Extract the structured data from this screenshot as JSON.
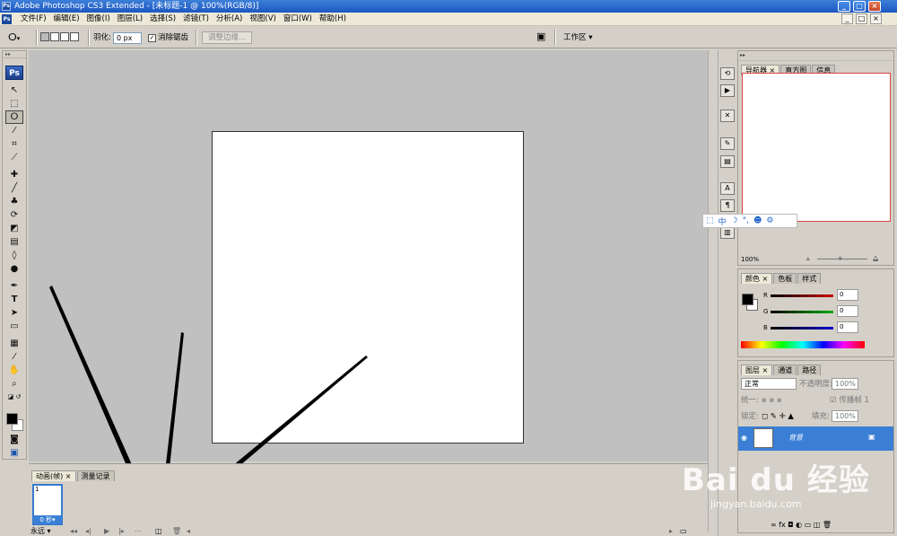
{
  "window": {
    "title": "Adobe Photoshop CS3 Extended - [未标题-1 @ 100%(RGB/8)]",
    "app_icon": "Ps",
    "controls": [
      "_",
      "□",
      "×"
    ]
  },
  "menubar": {
    "items": [
      "文件(F)",
      "编辑(E)",
      "图像(I)",
      "图层(L)",
      "选择(S)",
      "滤镜(T)",
      "分析(A)",
      "视图(V)",
      "窗口(W)",
      "帮助(H)"
    ],
    "doc_controls": [
      "_",
      "□",
      "×"
    ]
  },
  "options": {
    "feather_label": "羽化:",
    "feather_value": "0 px",
    "antialias_label": "消除锯齿",
    "antialias_checked": "✓",
    "refine_edge_label": "调整边缘...",
    "workspace_label": "工作区 ▾"
  },
  "toolbox": {
    "logo": "Ps",
    "tools": [
      "move-tool",
      "marquee-tool",
      "lasso-tool",
      "magic-wand-tool",
      "crop-tool",
      "slice-tool",
      "healing-brush-tool",
      "brush-tool",
      "clone-stamp-tool",
      "history-brush-tool",
      "eraser-tool",
      "gradient-tool",
      "blur-tool",
      "dodge-tool",
      "pen-tool",
      "type-tool",
      "path-selection-tool",
      "shape-tool",
      "notes-tool",
      "eyedropper-tool",
      "hand-tool",
      "zoom-tool"
    ]
  },
  "animation_panel": {
    "tabs": [
      "动画(帧)",
      "测量记录"
    ],
    "frame_number": "1",
    "frame_delay": "0 秒▾",
    "loop": "永远 ▾"
  },
  "navigator": {
    "tabs": [
      "导航器",
      "直方图",
      "信息"
    ],
    "zoom": "100%"
  },
  "color_panel": {
    "tabs": [
      "颜色",
      "色板",
      "样式"
    ],
    "channels": [
      {
        "label": "R",
        "value": "0",
        "color": "#cc0000"
      },
      {
        "label": "G",
        "value": "0",
        "color": "#00aa00"
      },
      {
        "label": "B",
        "value": "0",
        "color": "#0000cc"
      }
    ]
  },
  "layers_panel": {
    "tabs": [
      "图层",
      "通道",
      "路径"
    ],
    "blend_mode": "正常",
    "opacity_label": "不透明度:",
    "opacity_value": "100%",
    "unify_label": "统一:",
    "propagate_label": "传播帧 1",
    "lock_label": "锁定:",
    "fill_label": "填充:",
    "fill_value": "100%",
    "layer_name": "背景"
  },
  "ime_bar": {
    "mode": "中"
  },
  "watermark": {
    "brand": "Bai du 经验",
    "url": "jingyan.baidu.com"
  }
}
